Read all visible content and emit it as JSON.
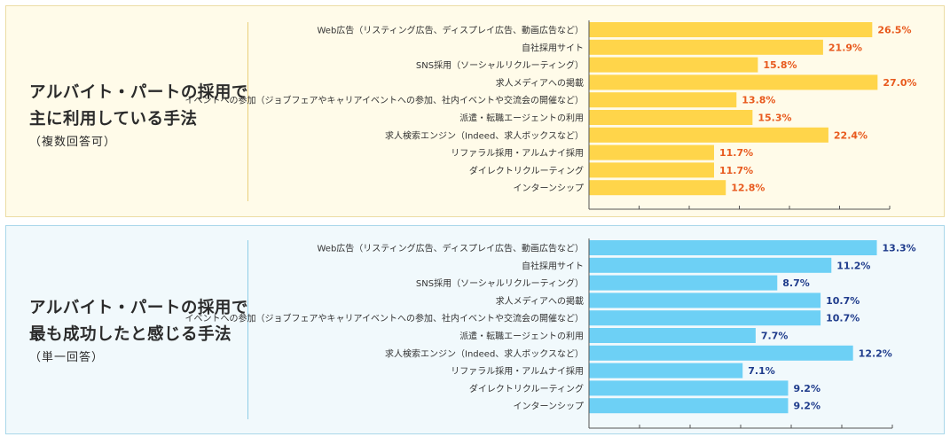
{
  "panels": [
    {
      "heading_line1": "アルバイト・パートの採用で",
      "heading_line2": "主に利用している手法",
      "heading_note": "（複数回答可）",
      "bar_color": "#ffd54a",
      "value_color": "#e85a1e",
      "axis_color": "#555555"
    },
    {
      "heading_line1": "アルバイト・パートの採用で",
      "heading_line2": "最も成功したと感じる手法",
      "heading_note": "（単一回答）",
      "bar_color": "#6dd0f5",
      "value_color": "#1f3c8c",
      "axis_color": "#555555"
    }
  ],
  "chart_data": [
    {
      "type": "bar",
      "orientation": "horizontal",
      "categories": [
        "Web広告（リスティング広告、ディスプレイ広告、動画広告など）",
        "自社採用サイト",
        "SNS採用（ソーシャルリクルーティング）",
        "求人メディアへの掲載",
        "イベントへの参加（ジョブフェアやキャリアイベントへの参加、社内イベントや交流会の開催など）",
        "派遣・転職エージェントの利用",
        "求人検索エンジン（Indeed、求人ボックスなど）",
        "リファラル採用・アルムナイ採用",
        "ダイレクトリクルーティング",
        "インターンシップ"
      ],
      "values": [
        26.5,
        21.9,
        15.8,
        27.0,
        13.8,
        15.3,
        22.4,
        11.7,
        11.7,
        12.8
      ],
      "value_labels": [
        "26.5%",
        "21.9%",
        "15.8%",
        "27.0%",
        "13.8%",
        "15.3%",
        "22.4%",
        "11.7%",
        "11.7%",
        "12.8%"
      ],
      "xlim": [
        0,
        28
      ],
      "grid": false
    },
    {
      "type": "bar",
      "orientation": "horizontal",
      "categories": [
        "Web広告（リスティング広告、ディスプレイ広告、動画広告など）",
        "自社採用サイト",
        "SNS採用（ソーシャルリクルーティング）",
        "求人メディアへの掲載",
        "イベントへの参加（ジョブフェアやキャリアイベントへの参加、社内イベントや交流会の開催など）",
        "派遣・転職エージェントの利用",
        "求人検索エンジン（Indeed、求人ボックスなど）",
        "リファラル採用・アルムナイ採用",
        "ダイレクトリクルーティング",
        "インターンシップ"
      ],
      "values": [
        13.3,
        11.2,
        8.7,
        10.7,
        10.7,
        7.7,
        12.2,
        7.1,
        9.2,
        9.2
      ],
      "value_labels": [
        "13.3%",
        "11.2%",
        "8.7%",
        "10.7%",
        "10.7%",
        "7.7%",
        "12.2%",
        "7.1%",
        "9.2%",
        "9.2%"
      ],
      "xlim": [
        0,
        14
      ],
      "grid": false
    }
  ]
}
